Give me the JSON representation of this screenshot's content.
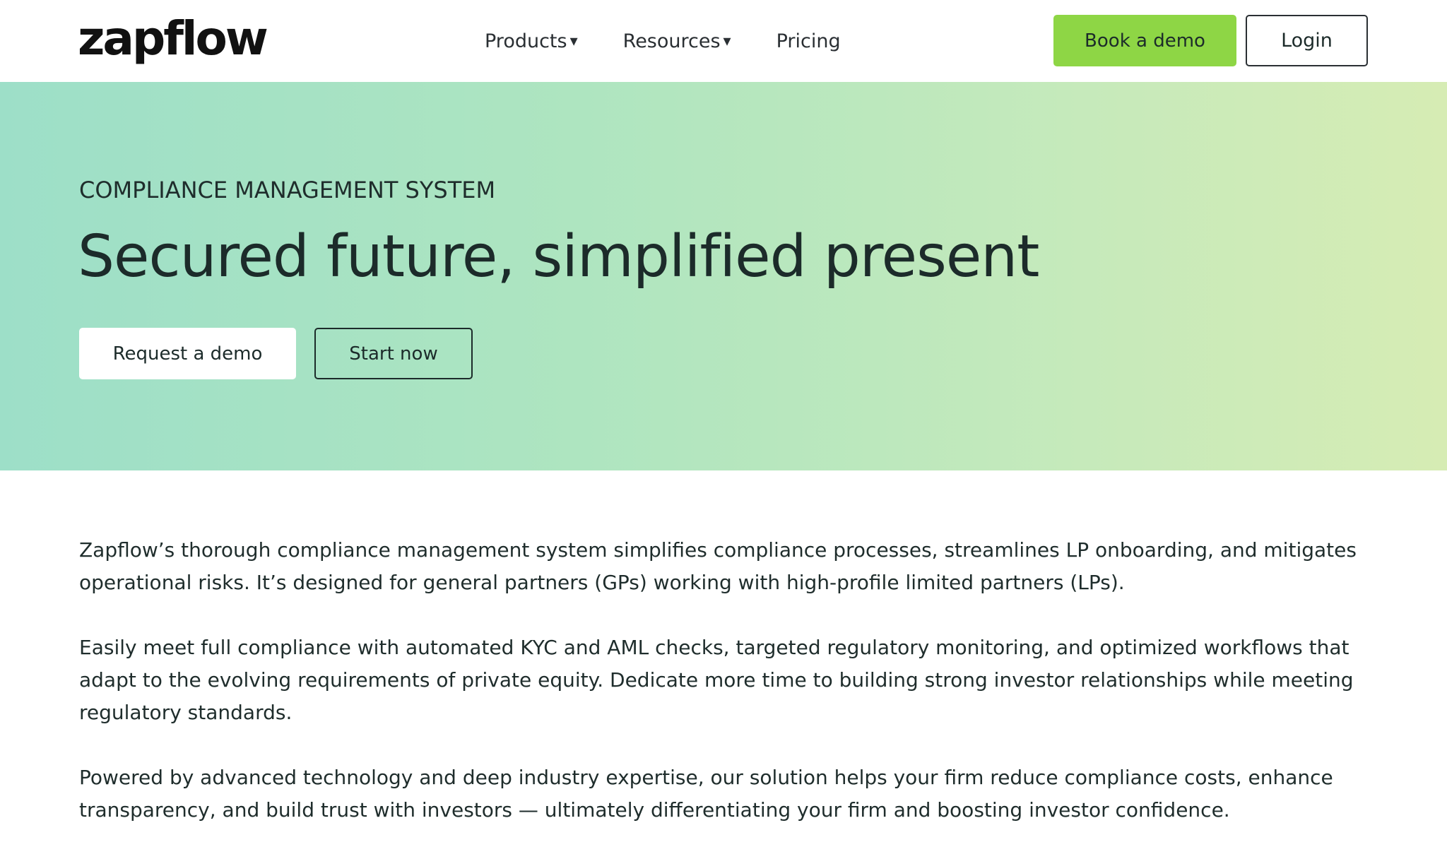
{
  "nav": {
    "logo": "zapflow",
    "links": [
      {
        "label": "Products",
        "has_dropdown": true
      },
      {
        "label": "Resources",
        "has_dropdown": true
      },
      {
        "label": "Pricing",
        "has_dropdown": false
      }
    ],
    "caret": "▾",
    "book_demo_label": "Book a demo",
    "login_label": "Login"
  },
  "hero": {
    "eyebrow": "COMPLIANCE MANAGEMENT SYSTEM",
    "headline": "Secured future, simplified present",
    "request_demo_label": "Request a demo",
    "start_now_label": "Start now"
  },
  "content": {
    "paragraphs": [
      "Zapflow’s thorough compliance management system simplifies compliance processes, streamlines LP onboarding, and mitigates operational risks. It’s designed for general partners (GPs) working with high-profile limited partners (LPs).",
      "Easily meet full compliance with automated KYC and AML checks, targeted regulatory monitoring, and optimized workflows that adapt to the evolving requirements of private equity. Dedicate more time to building strong investor relationships while meeting regulatory standards.",
      "Powered by advanced technology and deep industry expertise, our solution helps your firm reduce compliance costs, enhance transparency, and build trust with investors — ultimately differentiating your firm and boosting investor confidence."
    ]
  },
  "colors": {
    "accent_green": "#8ed645",
    "hero_gradient_start": "#9ddfc8",
    "hero_gradient_end": "#d6ecb4",
    "text_dark": "#1c2b2a"
  }
}
